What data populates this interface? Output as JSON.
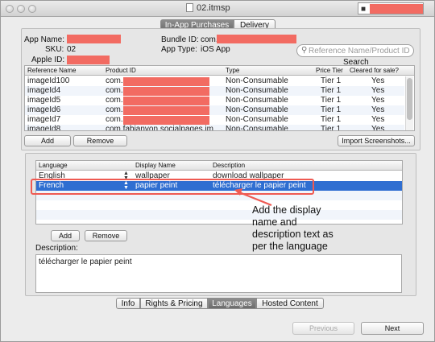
{
  "window": {
    "title": "02.itmsp",
    "top_tabs": [
      {
        "label": "In-App Purchases",
        "active": true
      },
      {
        "label": "Delivery",
        "active": false
      }
    ]
  },
  "app_info": {
    "app_name_label": "App Name:",
    "sku_label": "SKU:",
    "sku_value": "02",
    "apple_id_label": "Apple ID:",
    "bundle_id_label": "Bundle ID:",
    "bundle_id_value": "com.",
    "app_type_label": "App Type:",
    "app_type_value": "iOS App"
  },
  "search": {
    "placeholder": "Reference Name/Product ID",
    "label": "Search"
  },
  "iap_table": {
    "columns": [
      "Reference Name",
      "Product ID",
      "Type",
      "Price Tier",
      "Cleared for sale?"
    ],
    "rows": [
      {
        "ref": "imageId100",
        "product": "com.",
        "type": "Non-Consumable",
        "tier": "Tier 1",
        "cleared": "Yes",
        "selected": true
      },
      {
        "ref": "imageId4",
        "product": "com.",
        "type": "Non-Consumable",
        "tier": "Tier 1",
        "cleared": "Yes",
        "selected": false
      },
      {
        "ref": "imageId5",
        "product": "com.",
        "type": "Non-Consumable",
        "tier": "Tier 1",
        "cleared": "Yes",
        "selected": false
      },
      {
        "ref": "imageId6",
        "product": "com.",
        "type": "Non-Consumable",
        "tier": "Tier 1",
        "cleared": "Yes",
        "selected": false
      },
      {
        "ref": "imageId7",
        "product": "com.",
        "type": "Non-Consumable",
        "tier": "Tier 1",
        "cleared": "Yes",
        "selected": false
      },
      {
        "ref": "imageId8",
        "product": "com.fabianvon.socialpages.im",
        "type": "Non-Consumable",
        "tier": "Tier 1",
        "cleared": "Yes",
        "selected": false
      }
    ],
    "add_label": "Add",
    "remove_label": "Remove",
    "import_label": "Import Screenshots..."
  },
  "lang_table": {
    "columns": [
      "Language",
      "Display Name",
      "Description"
    ],
    "rows": [
      {
        "language": "English",
        "display": "wallpaper",
        "description": "download wallpaper",
        "selected": false
      },
      {
        "language": "French",
        "display": "papier peint",
        "description": "télécharger le papier peint",
        "selected": true
      }
    ],
    "add_label": "Add",
    "remove_label": "Remove"
  },
  "annotation": "Add the display name and description text as per the language",
  "description": {
    "label": "Description:",
    "value": "télécharger le papier peint"
  },
  "bottom_tabs": [
    {
      "label": "Info",
      "active": false
    },
    {
      "label": "Rights & Pricing",
      "active": false
    },
    {
      "label": "Languages",
      "active": true
    },
    {
      "label": "Hosted Content",
      "active": false
    }
  ],
  "nav": {
    "previous_label": "Previous",
    "next_label": "Next"
  },
  "colors": {
    "selection": "#2f6ed1",
    "redaction": "#f26b62",
    "annotation_box": "#ef5a52"
  }
}
